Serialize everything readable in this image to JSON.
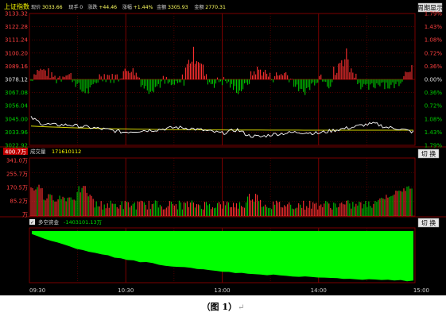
{
  "price_panel": {
    "title": "上证指数",
    "status_items": [
      {
        "label": "现价",
        "value": "3033.66"
      },
      {
        "label": "现手",
        "value": "0"
      },
      {
        "label": "涨跌",
        "value": "+44.46"
      },
      {
        "label": "涨幅",
        "value": "+1.44%"
      },
      {
        "label": "金额",
        "value": "3305.93"
      },
      {
        "label": "金额",
        "value": "2770.31"
      }
    ],
    "button_label": "周期显示",
    "left_ticks": [
      "3133.32",
      "3122.28",
      "3111.24",
      "3100.20",
      "3089.16",
      "3078.12",
      "3067.08",
      "3056.04",
      "3045.00",
      "3033.96",
      "3022.92"
    ],
    "right_ticks": [
      "1.79%",
      "1.43%",
      "1.08%",
      "0.72%",
      "0.36%",
      "0.00%",
      "0.36%",
      "0.72%",
      "1.08%",
      "1.43%",
      "1.79%"
    ]
  },
  "volume_panel": {
    "label": "成交量",
    "value": "171610112",
    "current_tick": "400.7万",
    "ticks": [
      "341.0万",
      "255.7万",
      "170.5万",
      "85.2万",
      "万"
    ],
    "button_label": "切 换"
  },
  "fund_panel": {
    "checkbox_mark": "✓",
    "label": "多空资金",
    "value": "-1403101.13万",
    "button_label": "切 换"
  },
  "time_axis": [
    "09:30",
    "10:30",
    "13:00",
    "14:00",
    "15:00"
  ],
  "caption": {
    "text": "（图 1）",
    "mark": "↵"
  },
  "colors": {
    "background": "#000000",
    "grid": "#7a0000",
    "rise": "#ff3030",
    "fall": "#00c400",
    "price_line": "#ffffff",
    "avg_line": "#d8d800",
    "fund_fill": "#00ff00",
    "tick_red": "#ff3030"
  },
  "chart_data": [
    {
      "type": "line",
      "series": [
        {
          "name": "",
          "values": []
        }
      ],
      "ylim": [
        3022.92,
        3133.32
      ],
      "note_points": [
        [
          0,
          3046
        ],
        [
          0.03,
          3041
        ],
        [
          0.06,
          3040
        ],
        [
          0.1,
          3040
        ],
        [
          0.15,
          3038
        ],
        [
          0.2,
          3036
        ],
        [
          0.24,
          3034
        ],
        [
          0.28,
          3035
        ],
        [
          0.33,
          3036
        ],
        [
          0.38,
          3038
        ],
        [
          0.42,
          3037
        ],
        [
          0.46,
          3035
        ],
        [
          0.5,
          3033
        ],
        [
          0.54,
          3036
        ],
        [
          0.57,
          3031
        ],
        [
          0.6,
          3030
        ],
        [
          0.63,
          3032
        ],
        [
          0.66,
          3033
        ],
        [
          0.7,
          3034
        ],
        [
          0.75,
          3033
        ],
        [
          0.8,
          3036
        ],
        [
          0.84,
          3038
        ],
        [
          0.87,
          3040
        ],
        [
          0.9,
          3041
        ],
        [
          0.93,
          3038
        ],
        [
          0.96,
          3037
        ],
        [
          1.0,
          3034
        ]
      ]
    }
  ]
}
